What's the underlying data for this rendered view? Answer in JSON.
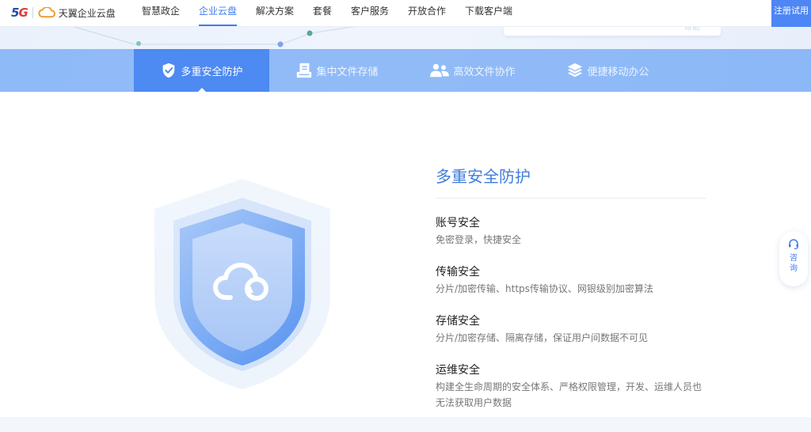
{
  "header": {
    "logo_5g": "5G",
    "logo_text": "天翼企业云盘",
    "nav": [
      {
        "label": "智慧政企"
      },
      {
        "label": "企业云盘",
        "active": true
      },
      {
        "label": "解决方案"
      },
      {
        "label": "套餐"
      },
      {
        "label": "客户服务"
      },
      {
        "label": "开放合作"
      },
      {
        "label": "下载客户端"
      }
    ],
    "register_label": "注册试用"
  },
  "hero": {
    "card_faint_text": "帮助"
  },
  "tabs": [
    {
      "label": "多重安全防护",
      "icon": "shield-check-icon",
      "active": true
    },
    {
      "label": "集中文件存储",
      "icon": "file-storage-icon"
    },
    {
      "label": "高效文件协作",
      "icon": "users-icon"
    },
    {
      "label": "便捷移动办公",
      "icon": "layers-icon"
    }
  ],
  "content": {
    "title": "多重安全防护",
    "features": [
      {
        "title": "账号安全",
        "desc": "免密登录，快捷安全"
      },
      {
        "title": "传输安全",
        "desc": "分片/加密传输、https传输协议、网银级别加密算法"
      },
      {
        "title": "存储安全",
        "desc": "分片/加密存储、隔离存储，保证用户间数据不可见"
      },
      {
        "title": "运维安全",
        "desc": "构建全生命周期的安全体系、严格权限管理，开发、运维人员也无法获取用户数据"
      }
    ]
  },
  "consult": {
    "label": "咨询"
  },
  "colors": {
    "accent": "#3d7cf2",
    "tabbar": "#8fbaf8",
    "tab_active": "#4d8af1",
    "title_blue": "#3f7cdc"
  }
}
